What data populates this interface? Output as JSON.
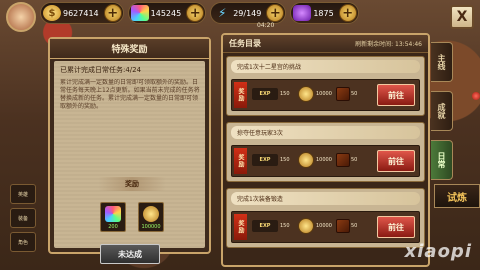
{
  "topbar": {
    "gold": "9627414",
    "gems": "145245",
    "stamina": "29/149",
    "stamina_timer": "04:20",
    "crystals": "1875",
    "plus": "+",
    "close": "X"
  },
  "left_panel": {
    "title": "特殊奖励",
    "progress": "已累计完成日常任务:4/24",
    "description": "累计完成满一定数量的日常即可领取额外的奖励。日常任务每天晚上12点更新。如果当前未完成的任务将替换成新的任务。累计完成满一定数量的日常即可领取额外的奖励。",
    "reward_label": "奖励",
    "rewards": [
      {
        "icon": "gem-icon",
        "value": "200"
      },
      {
        "icon": "coin-icon",
        "value": "100000"
      }
    ],
    "button": "未达成"
  },
  "right_panel": {
    "title": "任务目录",
    "refresh_label": "刷新剩余时间:",
    "refresh_time": "13:54:46",
    "tasks": [
      {
        "name": "完成1次十二星宫的挑战",
        "tag": "奖励",
        "exp_label": "EXP",
        "exp": "150",
        "gold": "10000",
        "book": "50",
        "button": "前往"
      },
      {
        "name": "掠夺任意玩家3次",
        "tag": "奖励",
        "exp_label": "EXP",
        "exp": "150",
        "gold": "10000",
        "book": "50",
        "button": "前往"
      },
      {
        "name": "完成1次装备锻造",
        "tag": "奖励",
        "exp_label": "EXP",
        "exp": "150",
        "gold": "10000",
        "book": "50",
        "button": "前往"
      }
    ]
  },
  "side_tabs": [
    "主线",
    "成就",
    "日常"
  ],
  "trial": "试炼",
  "watermark": "xiaopi",
  "left_menu": [
    "英雄",
    "装备",
    "角色"
  ]
}
